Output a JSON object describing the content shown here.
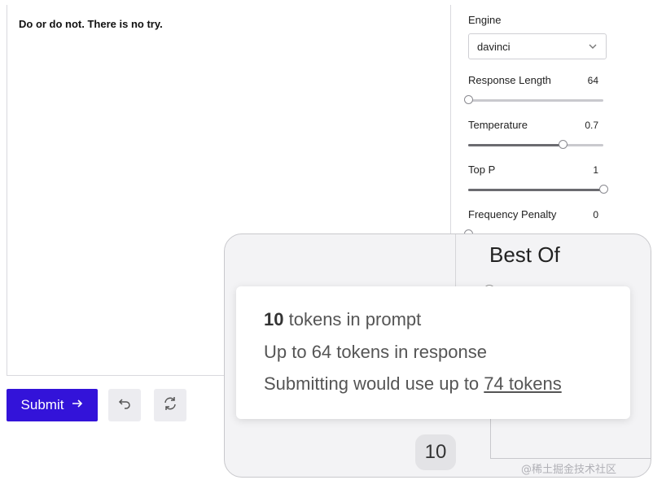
{
  "editor": {
    "text": "Do or do not. There is no try."
  },
  "actions": {
    "submit_label": "Submit",
    "undo_icon": "undo-icon",
    "regenerate_icon": "regenerate-icon"
  },
  "panel": {
    "engine_label": "Engine",
    "engine_value": "davinci",
    "sliders": [
      {
        "label": "Response Length",
        "value": "64",
        "level": 0.0
      },
      {
        "label": "Temperature",
        "value": "0.7",
        "level": 0.7
      },
      {
        "label": "Top P",
        "value": "1",
        "level": 1.0
      },
      {
        "label": "Frequency Penalty",
        "value": "0",
        "level": 0.0
      }
    ]
  },
  "zoom": {
    "best_of_label": "Best Of",
    "best_of_value": "10",
    "tooltip": {
      "prompt_count": "10",
      "prompt_suffix": "tokens in prompt",
      "response_line": "Up to 64 tokens in response",
      "usage_prefix": "Submitting would use up to",
      "usage_link": "74 tokens"
    }
  },
  "watermark": "@稀土掘金技术社区",
  "colors": {
    "submit": "#3313d9"
  }
}
